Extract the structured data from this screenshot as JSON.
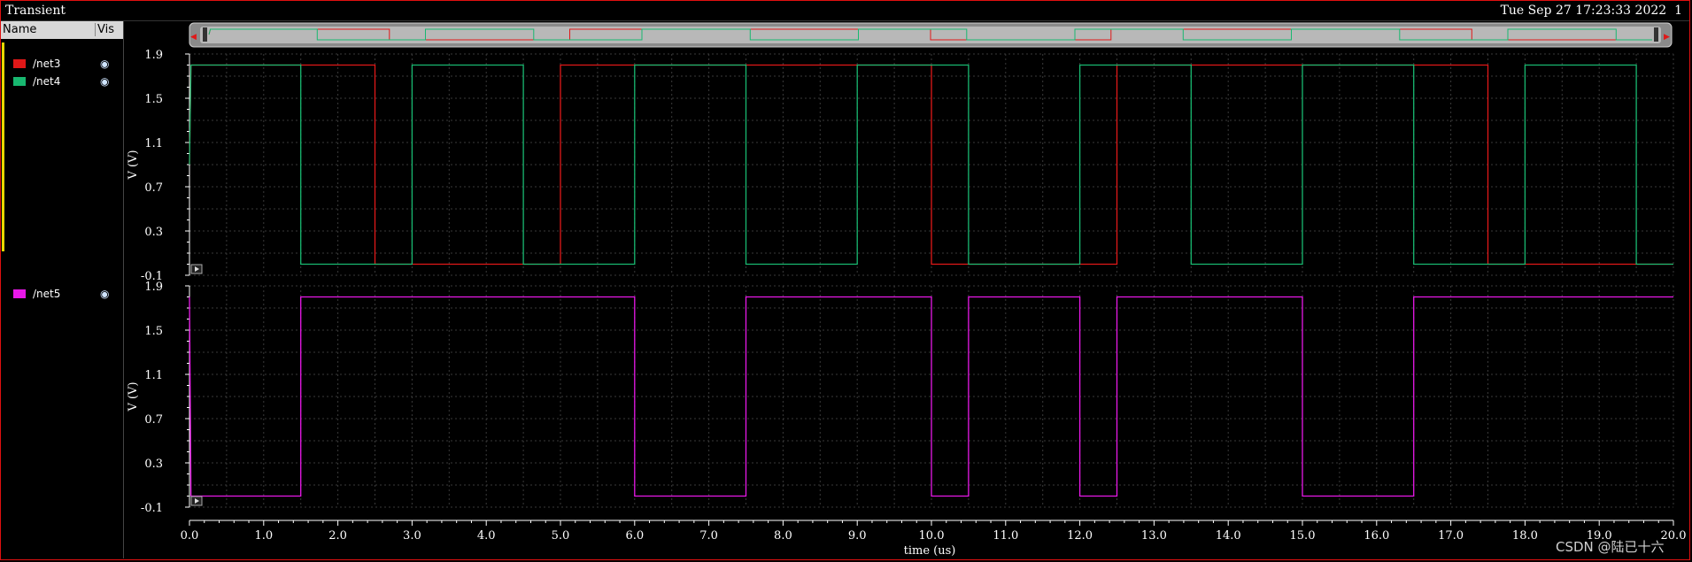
{
  "window": {
    "title": "Transient",
    "timestamp": "Tue Sep 27 17:23:33 2022",
    "subwin_index": "1"
  },
  "signal_list": {
    "headers": {
      "name": "Name",
      "vis": "Vis"
    },
    "signals": [
      {
        "name": "/net3",
        "color": "#e01818"
      },
      {
        "name": "/net4",
        "color": "#18b870"
      },
      {
        "name": "/net5",
        "color": "#e818e8"
      }
    ],
    "eye_icon": "eye-icon"
  },
  "colors": {
    "frame": "#e01010",
    "grid": "#3a3a3a",
    "background": "#000000"
  },
  "watermark": "CSDN @陆已十六",
  "chart_data": {
    "type": "line",
    "x_label": "time (us)",
    "x_ticks": [
      "0.0",
      "1.0",
      "2.0",
      "3.0",
      "4.0",
      "5.0",
      "6.0",
      "7.0",
      "8.0",
      "9.0",
      "10.0",
      "11.0",
      "12.0",
      "13.0",
      "14.0",
      "15.0",
      "16.0",
      "17.0",
      "18.0",
      "19.0",
      "20.0"
    ],
    "xlim": [
      0,
      20
    ],
    "grid": true,
    "strips": [
      {
        "ylabel": "V (V)",
        "y_ticks": [
          "1.9",
          "1.5",
          "1.1",
          "0.7",
          "0.3",
          "-0.1"
        ],
        "ylim": [
          -0.1,
          1.9
        ],
        "series": [
          {
            "name": "/net3",
            "color": "#e01818",
            "t": [
              0,
              0.02,
              2.5,
              2.5,
              5.0,
              5.0,
              10.0,
              10.0,
              12.5,
              12.5,
              17.5,
              17.5,
              20.0
            ],
            "v": [
              0.9,
              1.8,
              1.8,
              0.0,
              0.0,
              1.8,
              1.8,
              0.0,
              0.0,
              1.8,
              1.8,
              0.0,
              0.0
            ]
          },
          {
            "name": "/net4",
            "color": "#18b870",
            "t": [
              0,
              0.02,
              1.5,
              1.5,
              3.0,
              3.0,
              4.5,
              4.5,
              6.0,
              6.0,
              7.5,
              7.5,
              9.0,
              9.0,
              10.5,
              10.5,
              12.0,
              12.0,
              13.5,
              13.5,
              15.0,
              15.0,
              16.5,
              16.5,
              18.0,
              18.0,
              19.5,
              19.5,
              20.0
            ],
            "v": [
              0.9,
              1.8,
              1.8,
              0.0,
              0.0,
              1.8,
              1.8,
              0.0,
              0.0,
              1.8,
              1.8,
              0.0,
              0.0,
              1.8,
              1.8,
              0.0,
              0.0,
              1.8,
              1.8,
              0.0,
              0.0,
              1.8,
              1.8,
              0.0,
              0.0,
              1.8,
              1.8,
              0.0,
              0.0
            ]
          }
        ]
      },
      {
        "ylabel": "V (V)",
        "y_ticks": [
          "1.9",
          "1.5",
          "1.1",
          "0.7",
          "0.3",
          "-0.1"
        ],
        "ylim": [
          -0.1,
          1.9
        ],
        "series": [
          {
            "name": "/net5",
            "color": "#e818e8",
            "t": [
              0,
              0.02,
              1.5,
              1.5,
              6.0,
              6.0,
              7.5,
              7.5,
              10.0,
              10.0,
              10.5,
              10.5,
              12.0,
              12.0,
              12.5,
              12.5,
              15.0,
              15.0,
              16.5,
              16.5,
              20.0
            ],
            "v": [
              1.8,
              0.0,
              0.0,
              1.8,
              1.8,
              0.0,
              0.0,
              1.8,
              1.8,
              0.0,
              0.0,
              1.8,
              1.8,
              0.0,
              0.0,
              1.8,
              1.8,
              0.0,
              0.0,
              1.8,
              1.8
            ]
          }
        ]
      }
    ]
  }
}
